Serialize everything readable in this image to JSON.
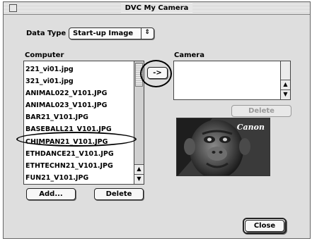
{
  "window": {
    "title": "DVC My Camera"
  },
  "data_type": {
    "label": "Data Type",
    "selected": "Start-up Image",
    "arrows": "⇕"
  },
  "computer": {
    "label": "Computer",
    "files": [
      "221_vi01.jpg",
      "321_vi01.jpg",
      "ANIMAL022_V101.JPG",
      "ANIMAL023_V101.JPG",
      "BAR21_V101.JPG",
      "BASEBALL21_V101.JPG",
      "CHIMPAN21_V101.JPG",
      "ETHDANCE21_V101.JPG",
      "ETHTECHN21_V101.JPG",
      "FUN21_V101.JPG"
    ],
    "highlighted_file": "CHIMPAN21_V101.JPG",
    "add_label": "Add...",
    "delete_label": "Delete"
  },
  "transfer": {
    "label": "->"
  },
  "camera": {
    "label": "Camera",
    "delete_label": "Delete"
  },
  "preview": {
    "logo": "Canon",
    "subject": "chimpanzee"
  },
  "footer": {
    "close_label": "Close"
  }
}
